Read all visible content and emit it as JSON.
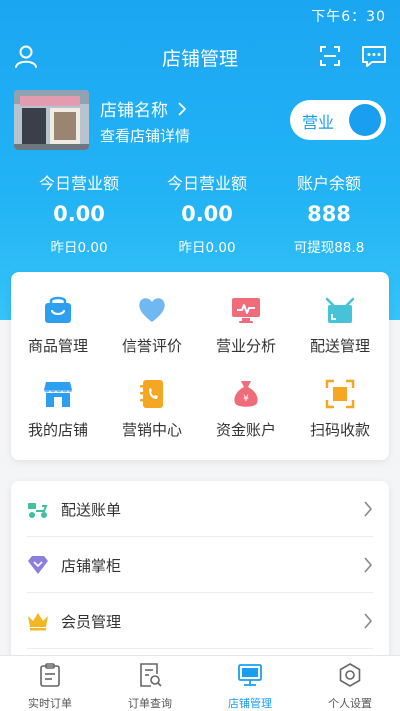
{
  "status_bar": {
    "time": "下午6：30"
  },
  "nav": {
    "title": "店铺管理"
  },
  "store": {
    "name": "店铺名称",
    "detail": "查看店铺详情",
    "toggle_label": "营业"
  },
  "stats": [
    {
      "title": "今日营业额",
      "value": "0.00",
      "sub": "昨日0.00"
    },
    {
      "title": "今日营业额",
      "value": "0.00",
      "sub": "昨日0.00"
    },
    {
      "title": "账户余额",
      "value": "888",
      "sub": "可提现88.8"
    }
  ],
  "grid": [
    {
      "label": "商品管理",
      "icon": "basket-icon"
    },
    {
      "label": "信誉评价",
      "icon": "heart-icon"
    },
    {
      "label": "营业分析",
      "icon": "monitor-chart-icon"
    },
    {
      "label": "配送管理",
      "icon": "delivery-box-icon"
    },
    {
      "label": "我的店铺",
      "icon": "shop-icon"
    },
    {
      "label": "营销中心",
      "icon": "phone-book-icon"
    },
    {
      "label": "资金账户",
      "icon": "money-bag-icon"
    },
    {
      "label": "扫码收款",
      "icon": "scan-frame-icon"
    }
  ],
  "list": [
    {
      "label": "配送账单",
      "icon": "scooter-icon"
    },
    {
      "label": "店铺掌柜",
      "icon": "diamond-icon"
    },
    {
      "label": "会员管理",
      "icon": "crown-icon"
    }
  ],
  "tabs": [
    {
      "label": "实时订单",
      "icon": "clipboard-icon"
    },
    {
      "label": "订单查询",
      "icon": "order-search-icon"
    },
    {
      "label": "店铺管理",
      "icon": "monitor-icon"
    },
    {
      "label": "个人设置",
      "icon": "settings-icon"
    }
  ],
  "colors": {
    "primary": "#1a9ef0",
    "header_gradient_end": "#35c3f8"
  }
}
